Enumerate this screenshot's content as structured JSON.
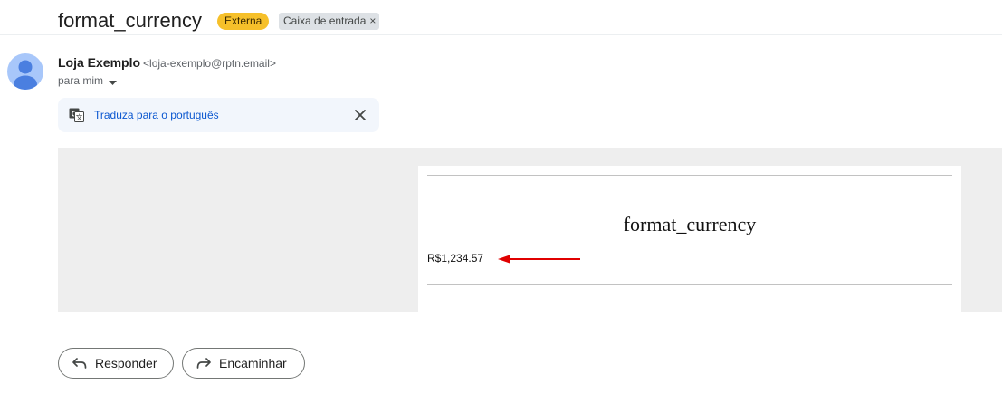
{
  "subject": {
    "title": "format_currency",
    "badge_externa": "Externa",
    "label": "Caixa de entrada",
    "label_remove": "×"
  },
  "sender": {
    "name": "Loja Exemplo",
    "email": "<loja-exemplo@rptn.email>",
    "recipient": "para mim"
  },
  "translate": {
    "link": "Traduza para o português"
  },
  "email_body": {
    "title": "format_currency",
    "currency_value": "R$1,234.57"
  },
  "actions": {
    "reply": "Responder",
    "forward": "Encaminhar"
  },
  "colors": {
    "badge_externa": "#f6c02a",
    "link": "#0b57d0",
    "arrow": "#e00000"
  }
}
